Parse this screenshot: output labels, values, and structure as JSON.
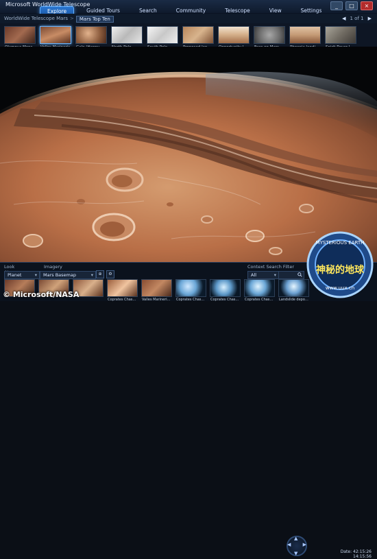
{
  "app": {
    "title": "Microsoft WorldWide Telescope",
    "nav_tabs": [
      "Explore",
      "Guided Tours",
      "Search",
      "Community",
      "Telescope",
      "View",
      "Settings"
    ],
    "active_tab": "Explore",
    "window_controls": [
      "_",
      "□",
      "×"
    ]
  },
  "breadcrumb": {
    "items": [
      "WorldWide Telescope Mars",
      "Mars Top Ten"
    ],
    "sep": ">"
  },
  "pager": {
    "prev": "◀",
    "text": "1 of 1",
    "next": "▶"
  },
  "thumbnails": [
    {
      "label": "Olympus Mons"
    },
    {
      "label": "Valles Marineris"
    },
    {
      "label": "Gale (Happy Face)"
    },
    {
      "label": "North Pole"
    },
    {
      "label": "South Pole"
    },
    {
      "label": "Proposed landi..."
    },
    {
      "label": "Opportunity lan..."
    },
    {
      "label": "Face on Mars in..."
    },
    {
      "label": "Phoenix landing..."
    },
    {
      "label": "Spirit Rover land..."
    }
  ],
  "bottom_panel": {
    "look_at_label": "Look At",
    "look_at_value": "Planet",
    "imagery_label": "Imagery",
    "imagery_value": "Mars Basemap",
    "context_label": "Context Search Filter",
    "context_value": "All",
    "thumbnails": [
      {
        "label": ""
      },
      {
        "label": ""
      },
      {
        "label": ""
      },
      {
        "label": "Coprates Chasma..."
      },
      {
        "label": "Valles Marineris..."
      },
      {
        "label": "Coprates Chasma..."
      },
      {
        "label": "Coprates Chasma..."
      },
      {
        "label": "Coprates Chasma..."
      },
      {
        "label": "Landslide deposi..."
      },
      {
        "label": ""
      }
    ]
  },
  "status": {
    "date_label": "Date:",
    "date_value": "42:15:26",
    "time_value": "14:15:56"
  },
  "overlays": {
    "credit": "© Microsoft/NASA",
    "badge_text": "神秘的地球",
    "badge_ring": "MYSTERIOUS EARTH",
    "badge_url": "www.uux.cn"
  },
  "colors": {
    "accent": "#2a76d1",
    "mars_base": "#b86a45"
  },
  "icons": {
    "search": "search-icon",
    "settings": "gear-icon"
  }
}
